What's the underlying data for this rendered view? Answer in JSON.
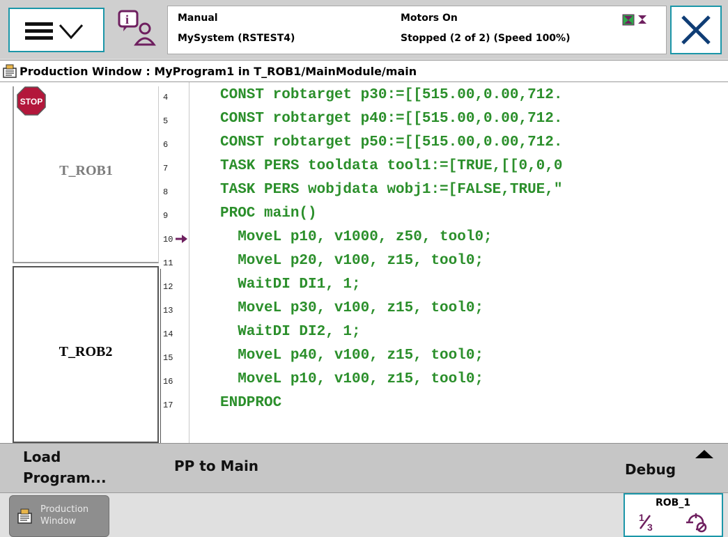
{
  "header": {
    "mode": "Manual",
    "system": "MySystem (RSTEST4)",
    "motors": "Motors On",
    "state": "Stopped (2 of 2) (Speed 100%)",
    "accent_color": "#1b96a8",
    "icons": [
      "hamburger-menu-icon",
      "chevron-down-icon",
      "event-log-icon",
      "robot-status-icon",
      "close-icon"
    ]
  },
  "window": {
    "title": "Production Window : MyProgram1 in T_ROB1/MainModule/main"
  },
  "tasks": [
    {
      "label": "T_ROB1",
      "status_icon": "stop-icon",
      "selected": false
    },
    {
      "label": "T_ROB2",
      "selected": true
    }
  ],
  "code": {
    "lines": [
      {
        "num": "4",
        "text": "CONST robtarget p30:=[[515.00,0.00,712."
      },
      {
        "num": "5",
        "text": "CONST robtarget p40:=[[515.00,0.00,712."
      },
      {
        "num": "6",
        "text": "CONST robtarget p50:=[[515.00,0.00,712."
      },
      {
        "num": "7",
        "text": "TASK PERS tooldata tool1:=[TRUE,[[0,0,0"
      },
      {
        "num": "8",
        "text": "TASK PERS wobjdata wobj1:=[FALSE,TRUE,\""
      },
      {
        "num": "9",
        "text": "PROC main()"
      },
      {
        "num": "10",
        "text": "  MoveL p10, v1000, z50, tool0;",
        "pp": true
      },
      {
        "num": "11",
        "text": "  MoveL p20, v100, z15, tool0;"
      },
      {
        "num": "12",
        "text": "  WaitDI DI1, 1;"
      },
      {
        "num": "13",
        "text": "  MoveL p30, v100, z15, tool0;"
      },
      {
        "num": "14",
        "text": "  WaitDI DI2, 1;"
      },
      {
        "num": "15",
        "text": "  MoveL p40, v100, z15, tool0;"
      },
      {
        "num": "16",
        "text": "  MoveL p10, v100, z15, tool0;"
      },
      {
        "num": "17",
        "text": "ENDPROC"
      }
    ],
    "code_color": "#2b8f2b"
  },
  "commands": {
    "load_program": "Load Program...",
    "pp_to_main": "PP to Main",
    "debug": "Debug"
  },
  "taskbar": {
    "app_label_line1": "Production",
    "app_label_line2": "Window",
    "rob_label": "ROB_1"
  }
}
